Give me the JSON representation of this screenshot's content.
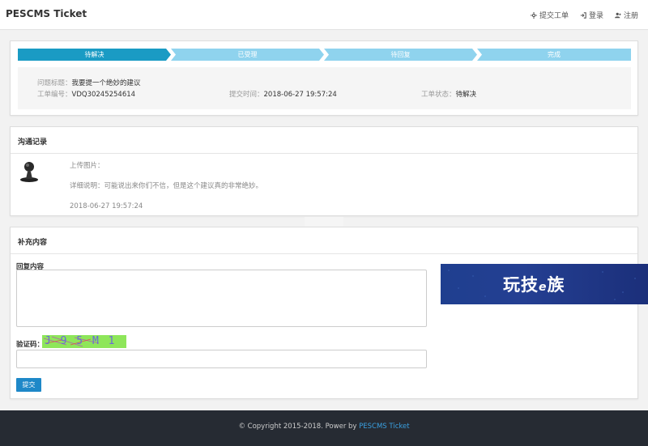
{
  "header": {
    "brand": "PESCMS Ticket",
    "nav": [
      {
        "label": "提交工单",
        "icon": "settings-icon"
      },
      {
        "label": "登录",
        "icon": "login-icon"
      },
      {
        "label": "注册",
        "icon": "add-user-icon"
      }
    ]
  },
  "progress": {
    "steps": [
      "待解决",
      "已受理",
      "待回复",
      "完成"
    ],
    "active_index": 0,
    "active_color": "#1a9bc4",
    "inactive_color": "#8fd3ee"
  },
  "ticket": {
    "title_label": "问题标题：",
    "title_value": "我要提一个绝妙的建议",
    "number_label": "工单编号：",
    "number_value": "VDQ30245254614",
    "time_label": "提交时间：",
    "time_value": "2018-06-27 19:57:24",
    "status_label": "工单状态：",
    "status_value": "待解决"
  },
  "communication": {
    "title": "沟通记录",
    "upload_text": "上传图片：",
    "detail_text": "详细说明：可能说出来你们不信，但是这个建议真的非常绝妙。",
    "timestamp": "2018-06-27 19:57:24"
  },
  "supplement": {
    "title": "补充内容",
    "reply_label": "回复内容",
    "reply_value": "",
    "captcha_label": "验证码：",
    "captcha_text": "J 9 5 M 1 U 3",
    "captcha_value": "",
    "submit_label": "提交"
  },
  "banner": {
    "text_before": "玩技",
    "text_e": "e",
    "text_after": "族"
  },
  "footer": {
    "copyright": "© Copyright 2015-2018. Power by ",
    "link": "PESCMS Ticket"
  }
}
